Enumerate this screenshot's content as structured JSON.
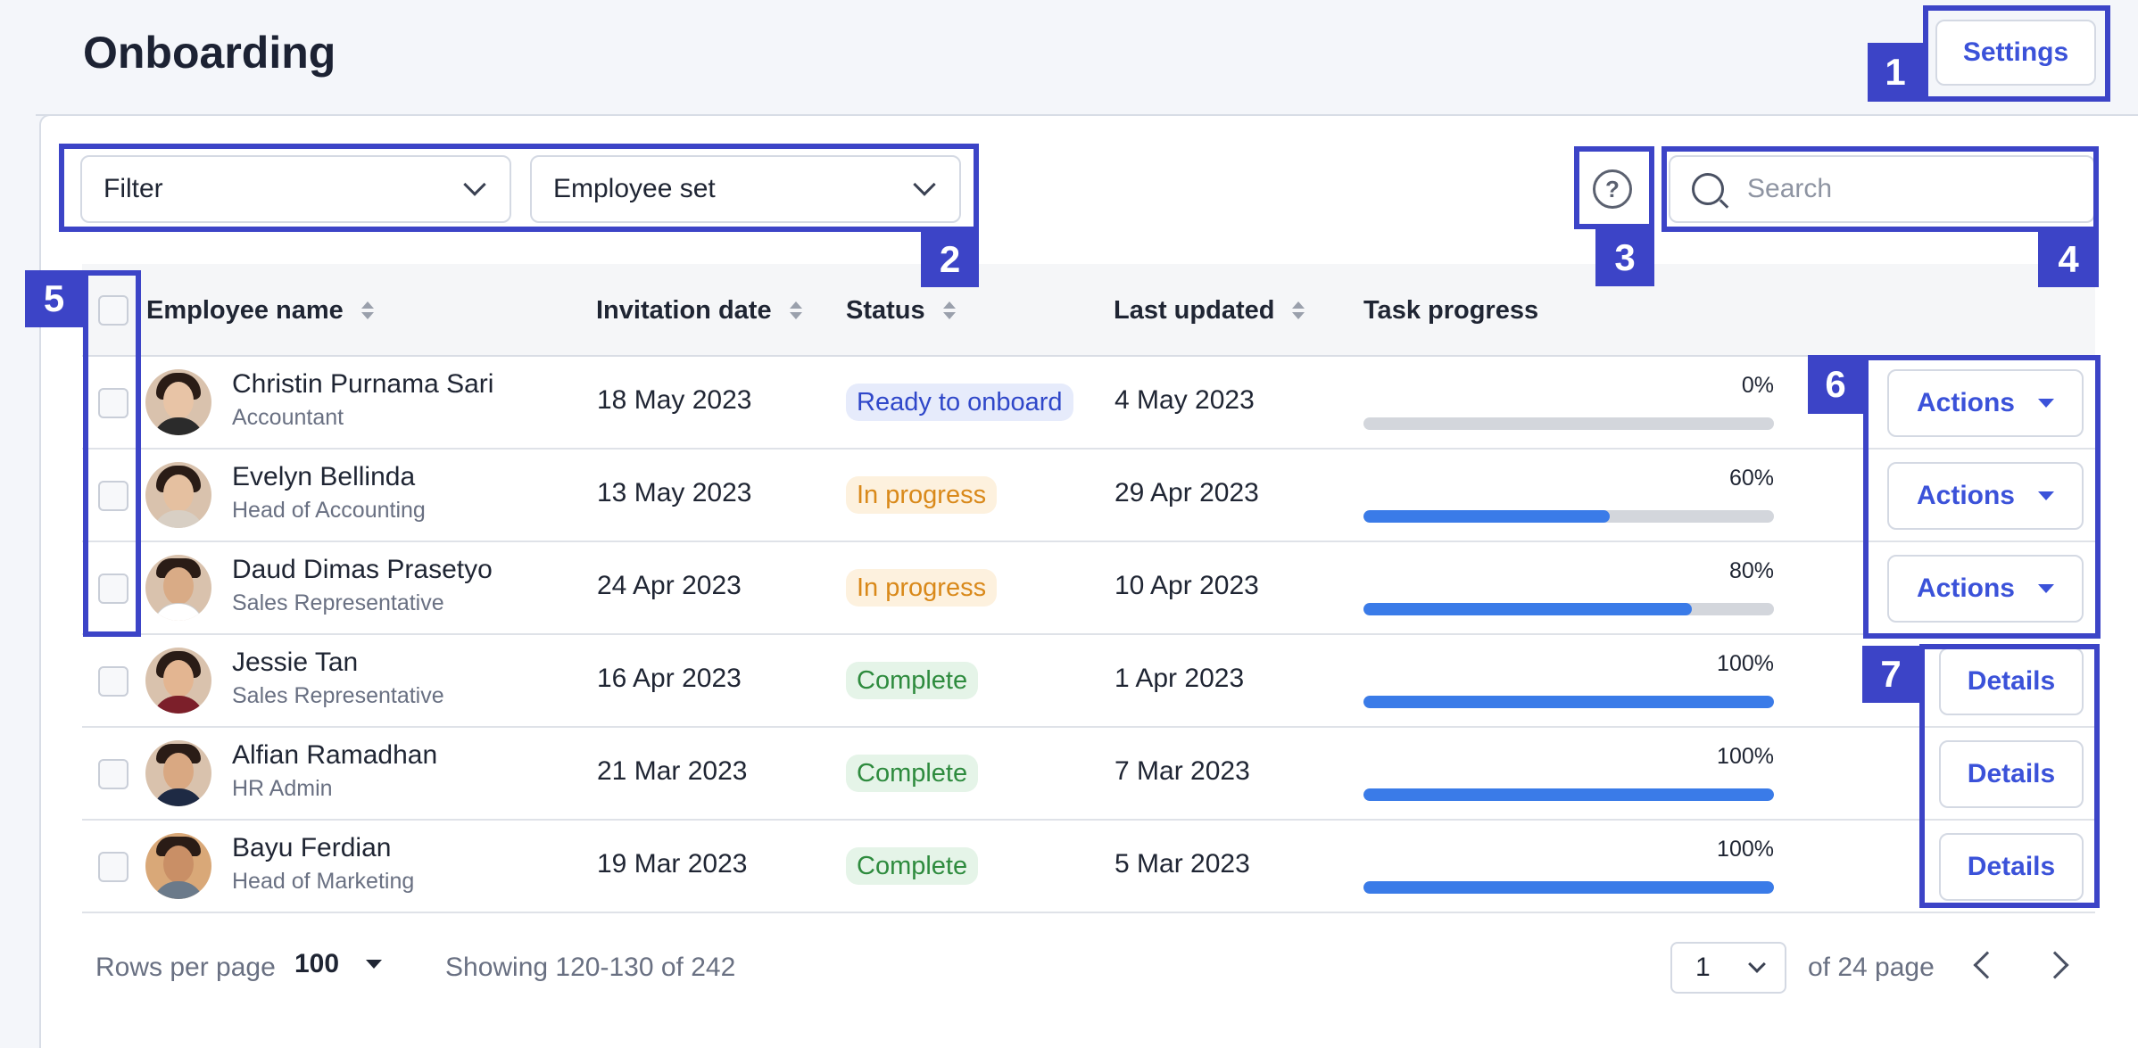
{
  "page": {
    "title": "Onboarding"
  },
  "header": {
    "settings_label": "Settings"
  },
  "filters": {
    "filter_label": "Filter",
    "employee_set_label": "Employee set",
    "help_symbol": "?"
  },
  "search": {
    "placeholder": "Search"
  },
  "table": {
    "columns": [
      "Employee name",
      "Invitation date",
      "Status",
      "Last updated",
      "Task progress"
    ],
    "rows": [
      {
        "name": "Christin Purnama Sari",
        "role": "Accountant",
        "invitation_date": "18 May 2023",
        "status": "Ready to onboard",
        "last_updated": "4 May 2023",
        "progress_label": "0%",
        "progress": 0,
        "action": "Actions"
      },
      {
        "name": "Evelyn Bellinda",
        "role": "Head of Accounting",
        "invitation_date": "13 May 2023",
        "status": "In progress",
        "last_updated": "29 Apr 2023",
        "progress_label": "60%",
        "progress": 60,
        "action": "Actions"
      },
      {
        "name": "Daud Dimas Prasetyo",
        "role": "Sales Representative",
        "invitation_date": "24 Apr 2023",
        "status": "In progress",
        "last_updated": "10 Apr 2023",
        "progress_label": "80%",
        "progress": 80,
        "action": "Actions"
      },
      {
        "name": "Jessie Tan",
        "role": "Sales Representative",
        "invitation_date": "16 Apr 2023",
        "status": "Complete",
        "last_updated": "1 Apr 2023",
        "progress_label": "100%",
        "progress": 100,
        "action": "Details"
      },
      {
        "name": "Alfian Ramadhan",
        "role": "HR Admin",
        "invitation_date": "21 Mar 2023",
        "status": "Complete",
        "last_updated": "7 Mar 2023",
        "progress_label": "100%",
        "progress": 100,
        "action": "Details"
      },
      {
        "name": "Bayu Ferdian",
        "role": "Head of Marketing",
        "invitation_date": "19 Mar 2023",
        "status": "Complete",
        "last_updated": "5 Mar 2023",
        "progress_label": "100%",
        "progress": 100,
        "action": "Details"
      }
    ]
  },
  "footer": {
    "rows_per_page_label": "Rows per page",
    "rows_per_page_value": "100",
    "showing": "Showing 120-130 of 242",
    "page_value": "1",
    "of_pages": "of 24 page"
  },
  "annotations": [
    "1",
    "2",
    "3",
    "4",
    "5",
    "6",
    "7"
  ],
  "colors": {
    "accent": "#3b52d9",
    "annotation": "#3c44c7",
    "progress_fill": "#3a7be8",
    "status_ready_bg": "#e6ebfb",
    "status_ready_text": "#2f47c9",
    "status_progress_bg": "#fdf1de",
    "status_progress_text": "#d9891a",
    "status_complete_bg": "#e5f4e8",
    "status_complete_text": "#2e8b3e"
  }
}
